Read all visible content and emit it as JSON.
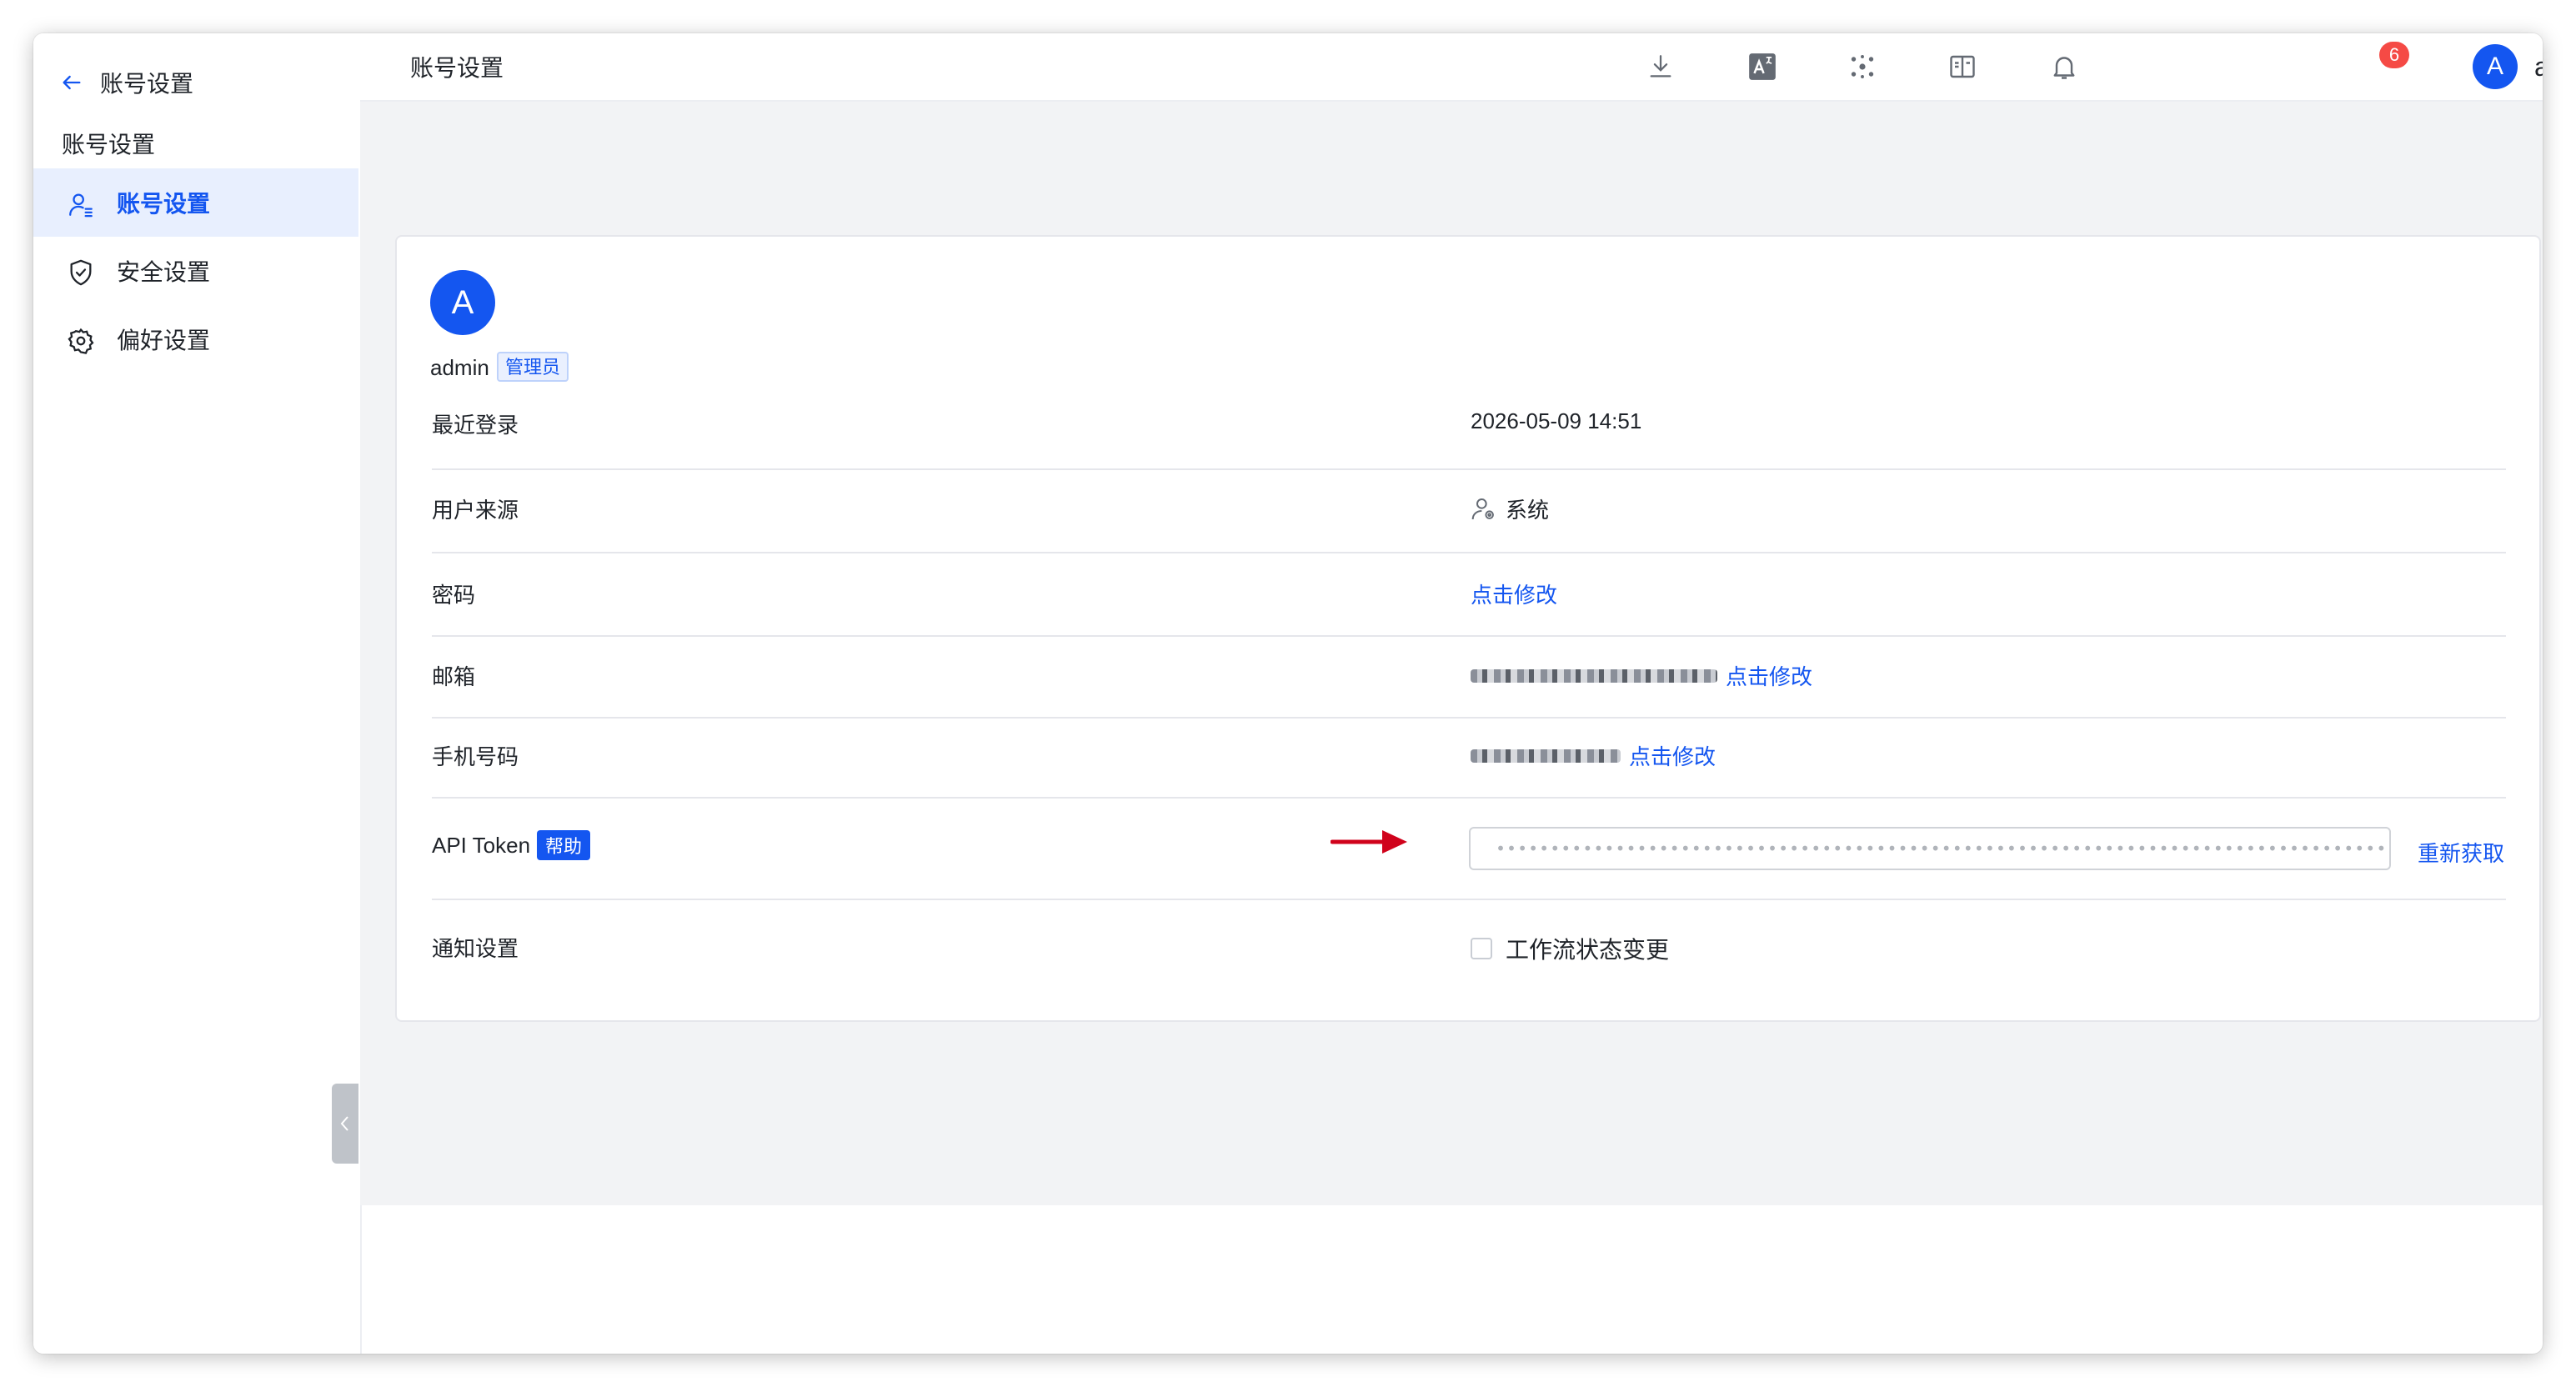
{
  "sidebar": {
    "header_title": "账号设置",
    "group_label": "账号设置",
    "items": [
      {
        "label": "账号设置",
        "icon": "user-settings-icon",
        "active": true
      },
      {
        "label": "安全设置",
        "icon": "shield-icon",
        "active": false
      },
      {
        "label": "偏好设置",
        "icon": "gear-icon",
        "active": false
      }
    ]
  },
  "topbar": {
    "title": "账号设置",
    "notification_count": "6",
    "user_initial": "A",
    "user_name": "admin(admin)"
  },
  "profile": {
    "avatar_initial": "A",
    "username": "admin",
    "role": "管理员"
  },
  "rows": {
    "last_login": {
      "label": "最近登录",
      "value": "2026-05-09 14:51"
    },
    "source": {
      "label": "用户来源",
      "value": "系统"
    },
    "password": {
      "label": "密码",
      "action": "点击修改"
    },
    "email": {
      "label": "邮箱",
      "action": "点击修改"
    },
    "phone": {
      "label": "手机号码",
      "action": "点击修改"
    },
    "api_token": {
      "label": "API Token",
      "help": "帮助",
      "masked_value": "•••••••••••••••••••••••••••••••••••••••••••••••••••••••••••••••••••••••••••••••••••••••",
      "action": "重新获取"
    },
    "notification": {
      "label": "通知设置",
      "option": "工作流状态变更",
      "checked": false
    }
  },
  "colors": {
    "accent": "#1456f0",
    "badge": "#f54a45",
    "arrow": "#d0021b",
    "main_bg": "#f2f3f5"
  }
}
